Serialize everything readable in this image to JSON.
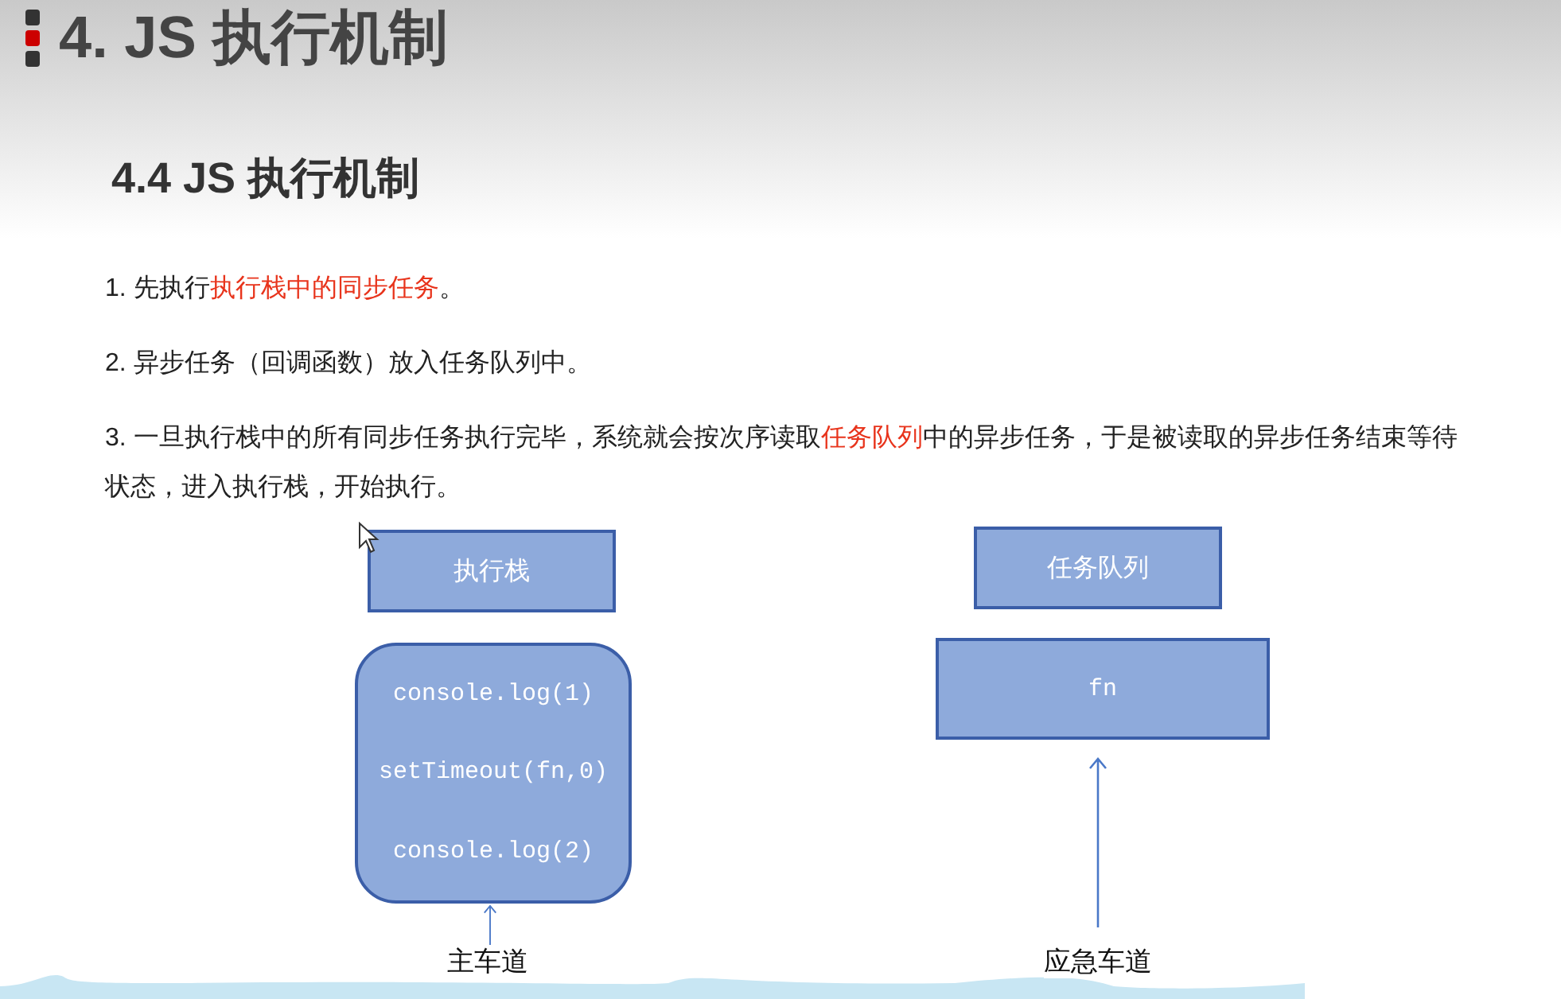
{
  "title": "4. JS 执行机制",
  "subtitle": "4.4 JS 执行机制",
  "points": [
    {
      "parts": [
        {
          "text": "1. 先执行",
          "highlight": false
        },
        {
          "text": "执行栈中的同步任务",
          "highlight": true
        },
        {
          "text": "。",
          "highlight": false
        }
      ]
    },
    {
      "parts": [
        {
          "text": "2. 异步任务（回调函数）放入任务队列中。",
          "highlight": false
        }
      ]
    },
    {
      "parts": [
        {
          "text": "3. 一旦执行栈中的所有同步任务执行完毕，系统就会按次序读取",
          "highlight": false
        },
        {
          "text": "任务队列",
          "highlight": true
        },
        {
          "text": "中的异步任务，于是被读取的异步任务结束等待状态，进入执行栈，开始执行。",
          "highlight": false
        }
      ]
    }
  ],
  "stack": {
    "header": "执行栈",
    "items": [
      "console.log(1)",
      "setTimeout(fn,0)",
      "console.log(2)"
    ],
    "label": "主车道"
  },
  "queue": {
    "header": "任务队列",
    "items": [
      "fn"
    ],
    "label": "应急车道"
  }
}
